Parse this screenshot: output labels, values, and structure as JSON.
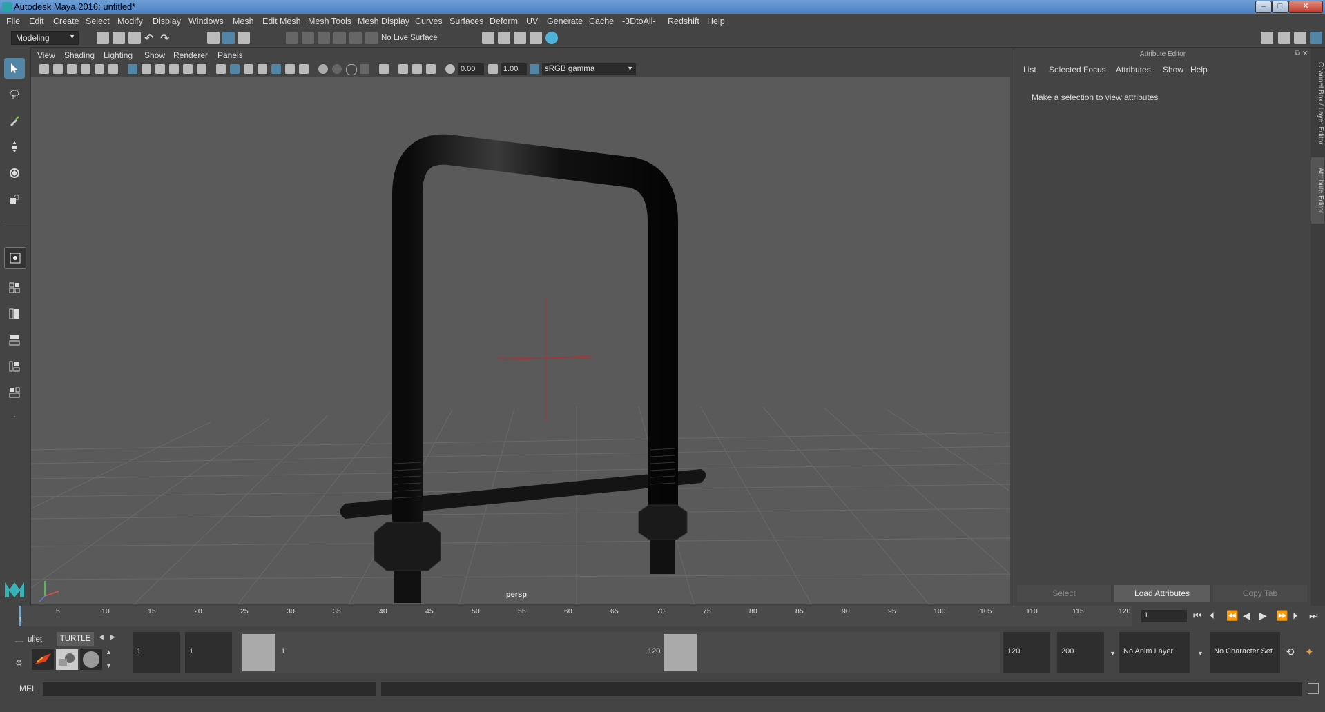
{
  "window": {
    "title": "Autodesk Maya 2016: untitled*",
    "minimize": "–",
    "maximize": "□",
    "close": "✕"
  },
  "menubar": {
    "items": [
      "File",
      "Edit",
      "Create",
      "Select",
      "Modify",
      "Display",
      "Windows",
      "Mesh",
      "Edit Mesh",
      "Mesh Tools",
      "Mesh Display",
      "Curves",
      "Surfaces",
      "Deform",
      "UV",
      "Generate",
      "Cache",
      "-3DtoAll-",
      "Redshift",
      "Help"
    ]
  },
  "statusline": {
    "mode": "Modeling",
    "live_surface": "No Live Surface"
  },
  "viewport": {
    "menu": [
      "View",
      "Shading",
      "Lighting",
      "Show",
      "Renderer",
      "Panels"
    ],
    "exposure": "0.00",
    "gamma": "1.00",
    "color_space": "sRGB gamma",
    "camera_label": "persp"
  },
  "attribute_editor": {
    "header": "Attribute Editor",
    "menu": [
      "List",
      "Selected",
      "Focus",
      "Attributes",
      "Show",
      "Help"
    ],
    "message": "Make a selection to view attributes",
    "buttons": {
      "select": "Select",
      "load": "Load Attributes",
      "copy": "Copy Tab"
    }
  },
  "side_tabs": {
    "channel_box": "Channel Box / Layer Editor",
    "attr_editor": "Attribute Editor"
  },
  "timeline": {
    "ticks": [
      "1",
      "5",
      "10",
      "15",
      "20",
      "25",
      "30",
      "35",
      "40",
      "45",
      "50",
      "55",
      "60",
      "65",
      "70",
      "75",
      "80",
      "85",
      "90",
      "95",
      "100",
      "105",
      "110",
      "115",
      "120"
    ],
    "current_frame": "1"
  },
  "range": {
    "shelf_tabs": [
      "ullet",
      "TURTLE"
    ],
    "start": "1",
    "playback_start": "1",
    "slider_start": "1",
    "slider_end": "120",
    "playback_end": "120",
    "end": "200",
    "anim_layer": "No Anim Layer",
    "character_set": "No Character Set"
  },
  "command": {
    "label": "MEL"
  }
}
